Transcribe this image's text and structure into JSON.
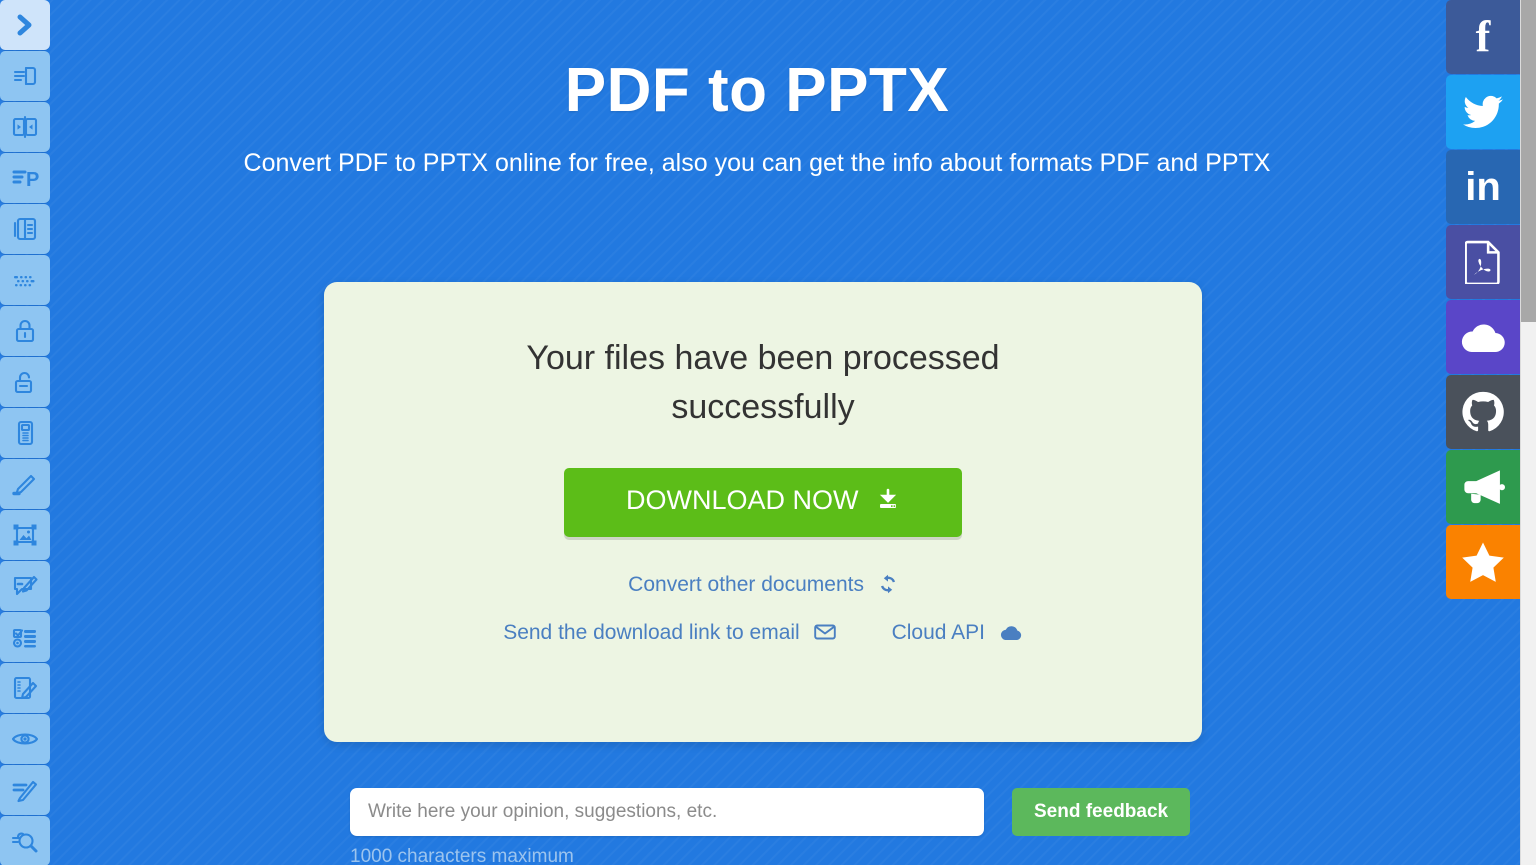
{
  "page": {
    "title": "PDF to PPTX",
    "subtitle": "Convert PDF to PPTX online for free, also you can get the info about formats PDF and PPTX",
    "background_color": "#2279e0"
  },
  "left_sidebar": {
    "items": [
      {
        "name": "toggle-sidebar",
        "icon": "chevron-right-icon",
        "active": true
      },
      {
        "name": "convert-file",
        "icon": "file-import-icon",
        "active": false
      },
      {
        "name": "compare-documents",
        "icon": "compare-icon",
        "active": false
      },
      {
        "name": "to-powerpoint",
        "icon": "document-to-presentation-icon",
        "active": false
      },
      {
        "name": "merge-documents",
        "icon": "merge-pages-icon",
        "active": false
      },
      {
        "name": "ocr-scan",
        "icon": "dotted-text-icon",
        "active": false
      },
      {
        "name": "protect-document",
        "icon": "lock-closed-icon",
        "active": false
      },
      {
        "name": "unlock-document",
        "icon": "lock-open-icon",
        "active": false
      },
      {
        "name": "document-metadata",
        "icon": "barcode-document-icon",
        "active": false
      },
      {
        "name": "annotate-document",
        "icon": "pen-highlight-icon",
        "active": false
      },
      {
        "name": "edit-image",
        "icon": "image-frame-icon",
        "active": false
      },
      {
        "name": "comment-document",
        "icon": "comment-edit-icon",
        "active": false
      },
      {
        "name": "form-fields",
        "icon": "checklist-icon",
        "active": false
      },
      {
        "name": "edit-document",
        "icon": "notebook-edit-icon",
        "active": false
      },
      {
        "name": "view-document",
        "icon": "eye-icon",
        "active": false
      },
      {
        "name": "sign-document",
        "icon": "signature-pen-icon",
        "active": false
      },
      {
        "name": "search-document",
        "icon": "magnifier-hand-icon",
        "active": false
      }
    ]
  },
  "social_rail": {
    "items": [
      {
        "name": "facebook",
        "label": "f",
        "color": "#3c5a99"
      },
      {
        "name": "twitter",
        "label": "",
        "color": "#1da1f2"
      },
      {
        "name": "linkedin",
        "label": "in",
        "color": "#2867b2"
      },
      {
        "name": "pdf",
        "label": "",
        "color": "#4a4fa3"
      },
      {
        "name": "cloud",
        "label": "",
        "color": "#5a46c8"
      },
      {
        "name": "github",
        "label": "",
        "color": "#4a515b"
      },
      {
        "name": "announcements",
        "label": "",
        "color": "#2e9a4e"
      },
      {
        "name": "favorites",
        "label": "",
        "color": "#fa8200"
      }
    ]
  },
  "result_card": {
    "heading": "Your files have been processed successfully",
    "download_label": "DOWNLOAD NOW",
    "download_color": "#5cbd18",
    "convert_other_label": "Convert other documents",
    "send_email_label": "Send the download link to email",
    "cloud_api_label": "Cloud API",
    "link_color": "#4a7fc1",
    "background_color": "#edf5e3"
  },
  "feedback": {
    "placeholder": "Write here your opinion, suggestions, etc.",
    "value": "",
    "send_label": "Send feedback",
    "send_color": "#5cb85c",
    "char_limit_note": "1000 characters maximum"
  }
}
